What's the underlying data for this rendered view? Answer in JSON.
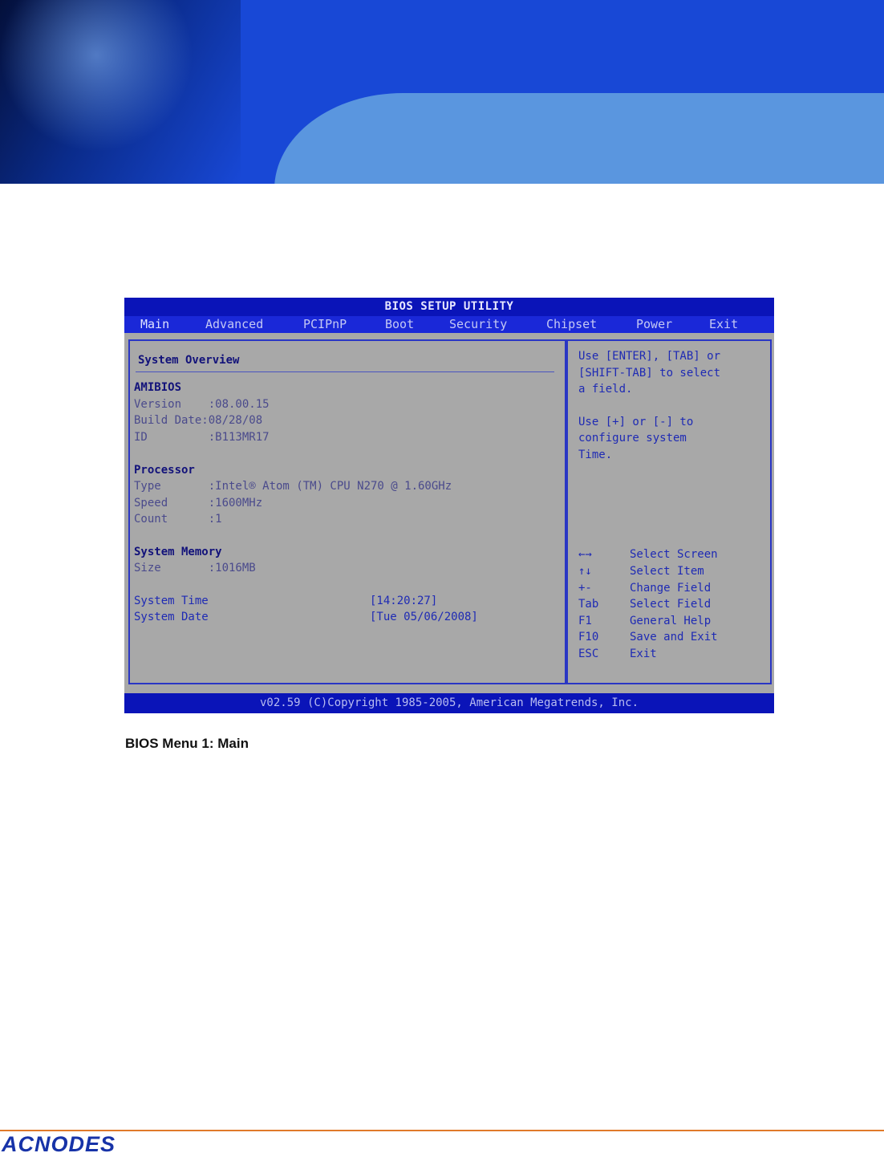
{
  "bios": {
    "title": "BIOS SETUP UTILITY",
    "menu": [
      "Main",
      "Advanced",
      "PCIPnP",
      "Boot",
      "Security",
      "Chipset",
      "Power",
      "Exit"
    ],
    "overview_title": "System Overview",
    "amibios": {
      "heading": "AMIBIOS",
      "version": "Version    :08.00.15",
      "build_date": "Build Date:08/28/08",
      "id": "ID         :B113MR17"
    },
    "processor": {
      "heading": "Processor",
      "type": "Type       :Intel® Atom (TM) CPU N270 @ 1.60GHz",
      "speed": "Speed      :1600MHz",
      "count": "Count      :1"
    },
    "memory": {
      "heading": "System Memory",
      "size": "Size       :1016MB"
    },
    "time": {
      "label": "System Time",
      "value": "[14:20:27]"
    },
    "date": {
      "label": "System Date",
      "value": "[Tue 05/06/2008]"
    },
    "help_lines": [
      "Use [ENTER], [TAB] or",
      "[SHIFT-TAB] to select",
      "a field.",
      "",
      "Use [+] or [-] to",
      "configure system",
      "Time."
    ],
    "keys": [
      {
        "key": "←→",
        "desc": "Select Screen"
      },
      {
        "key": "↑↓",
        "desc": "Select Item"
      },
      {
        "key": "+-",
        "desc": "Change Field"
      },
      {
        "key": "Tab",
        "desc": "Select Field"
      },
      {
        "key": "F1",
        "desc": "General Help"
      },
      {
        "key": "F10",
        "desc": "Save and Exit"
      },
      {
        "key": "ESC",
        "desc": "Exit"
      }
    ],
    "footer": "v02.59 (C)Copyright 1985-2005, American Megatrends, Inc."
  },
  "caption": "BIOS Menu 1: Main",
  "logo": "ACNODES",
  "colors": {
    "banner_blue": "#1848d6",
    "banner_pale": "#5a96df",
    "bios_blue": "#0a14b8",
    "bios_gray": "#a8a8a8",
    "footer_rule": "#e07a2a"
  }
}
